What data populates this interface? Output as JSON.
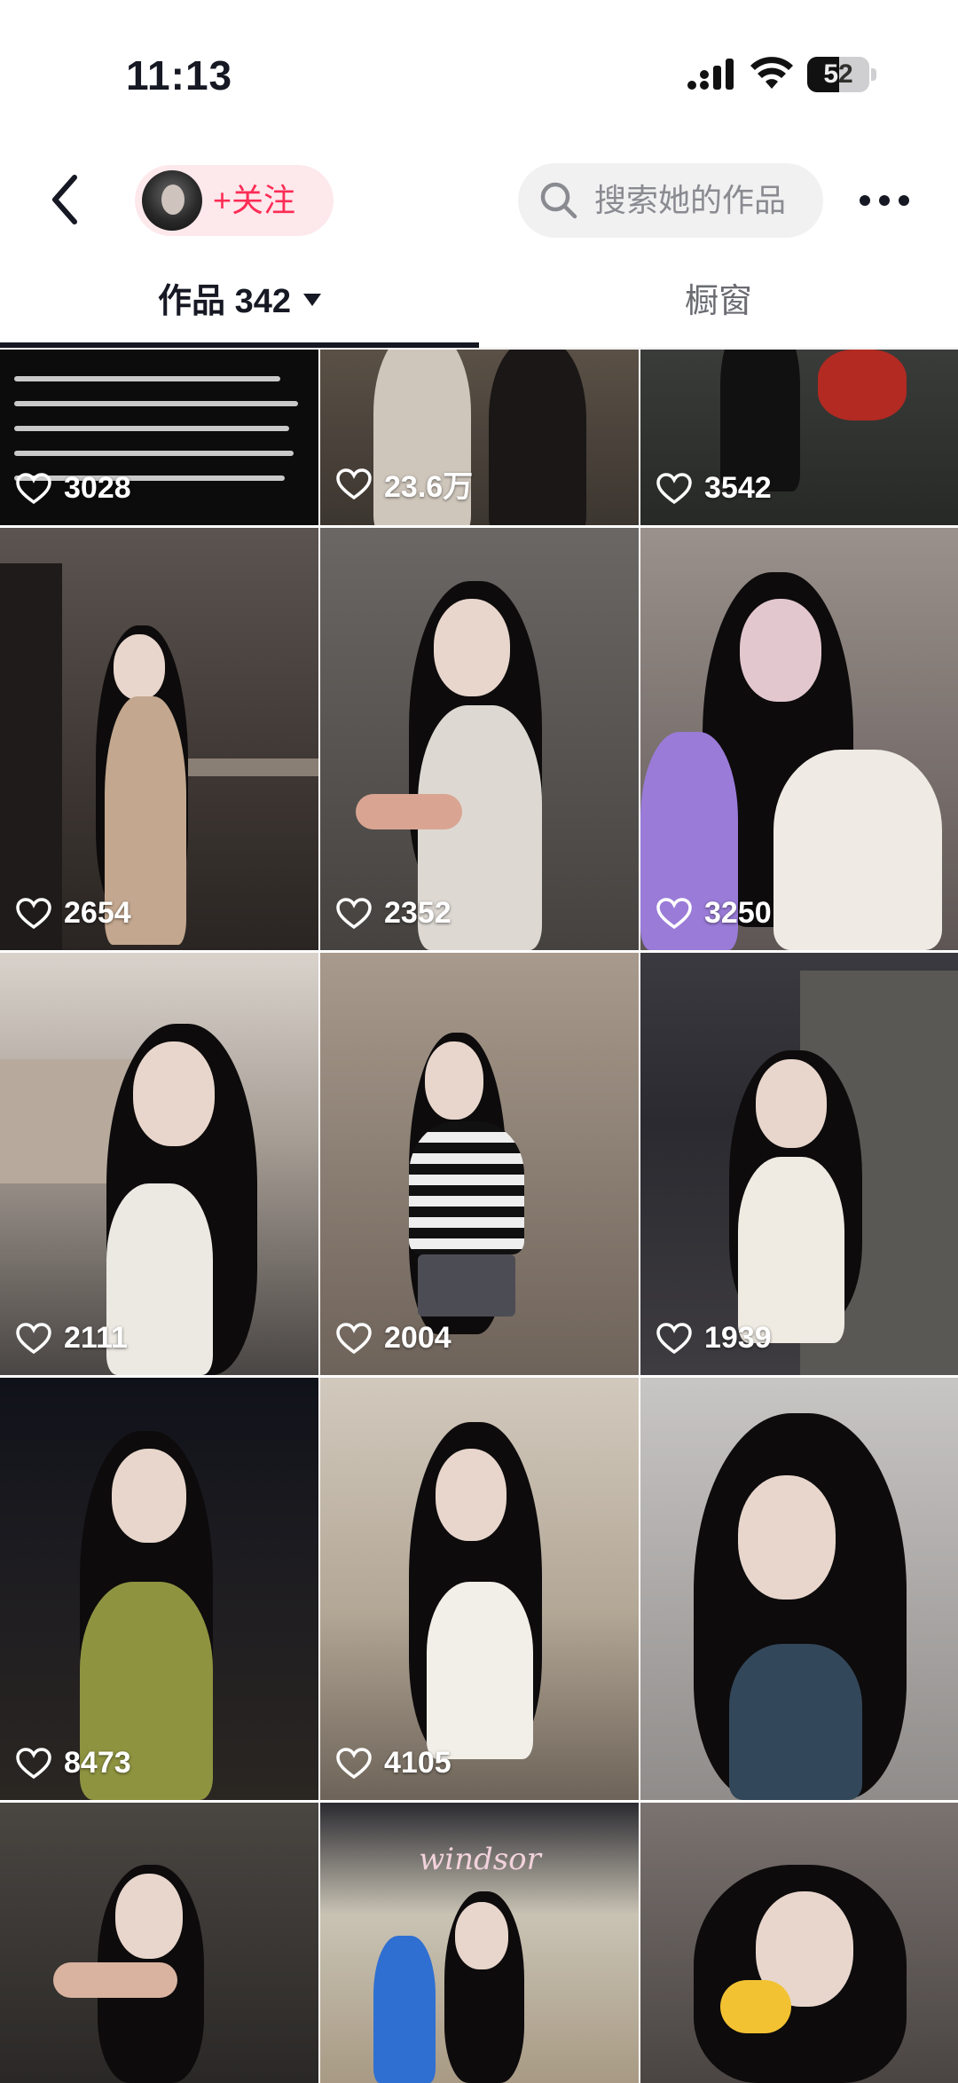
{
  "status_bar": {
    "time": "11:13",
    "battery": "52",
    "battery_level": 0.52,
    "icons": [
      "signal-icon",
      "wifi-icon",
      "battery-icon"
    ]
  },
  "header": {
    "back_icon": "chevron-left-icon",
    "follow_label": "+关注",
    "search_placeholder": "搜索她的作品",
    "more_icon": "more-dots-icon"
  },
  "tabs": [
    {
      "label": "作品 342",
      "selected": true
    },
    {
      "label": "橱窗",
      "selected": false
    }
  ],
  "colors": {
    "accent": "#fe2c55",
    "follow_bg": "#fde8ec",
    "search_bg": "#f1f1f2",
    "text": "#161823"
  },
  "videos": [
    {
      "likes": "3028"
    },
    {
      "likes": "23.6万"
    },
    {
      "likes": "3542"
    },
    {
      "likes": "2654"
    },
    {
      "likes": "2352"
    },
    {
      "likes": "3250"
    },
    {
      "likes": "2111"
    },
    {
      "likes": "2004"
    },
    {
      "likes": "1939"
    },
    {
      "likes": "8473"
    },
    {
      "likes": "4105"
    },
    {
      "likes": ""
    },
    {
      "likes": ""
    },
    {
      "likes": ""
    },
    {
      "likes": ""
    }
  ],
  "store_sign": "windsor"
}
